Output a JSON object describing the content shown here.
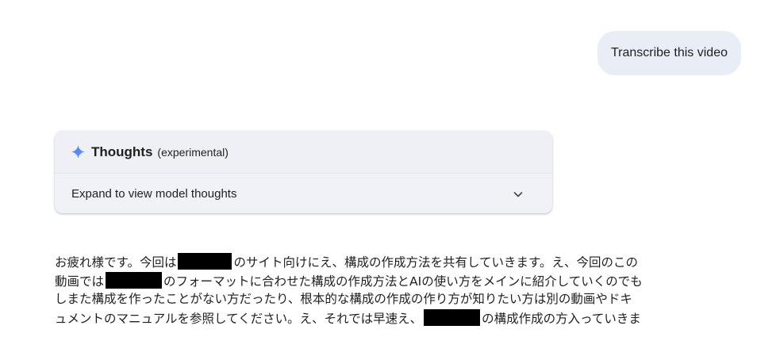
{
  "user_message": {
    "text": "Transcribe this video"
  },
  "thoughts_panel": {
    "title": "Thoughts",
    "subtitle": "(experimental)",
    "expand_label": "Expand to view model thoughts",
    "icon": "sparkle-icon",
    "accent_color": "#4285f4"
  },
  "transcript": {
    "line1": {
      "a": "お疲れ様です。今回は",
      "b": "のサイト向けにえ、構成の作成方法を共有していきます。え、今回のこの"
    },
    "line2": {
      "a": "動画では",
      "b": "のフォーマットに合わせた構成の作成方法とAIの使い方をメインに紹介していくのでも"
    },
    "line3": "しまた構成を作ったことがない方だったり、根本的な構成の作成の作り方が知りたい方は別の動画やドキ",
    "line4": {
      "a": "ュメントのマニュアルを参照してください。え、それでは早速え、",
      "b": "の構成作成の方入っていきま"
    },
    "redaction_color": "#000000"
  }
}
